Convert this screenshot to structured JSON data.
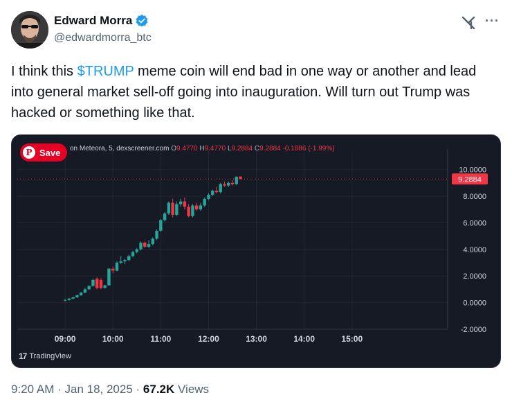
{
  "author": {
    "display_name": "Edward Morra",
    "handle": "@edwardmorra_btc",
    "verified": true
  },
  "tweet": {
    "text_before": "I think this ",
    "cashtag": "$TRUMP",
    "text_after": " meme coin will end bad in one way or another and lead into general market sell-off going into inauguration. Will turn out Trump was hacked or something like that."
  },
  "chart": {
    "source": "on Meteora, 5, dexscreener.com",
    "ohlc": {
      "o_label": "O",
      "o": "9.4770",
      "h_label": "H",
      "h": "9.4770",
      "l_label": "L",
      "l": "9.2884",
      "c_label": "C",
      "c": "9.2884",
      "change": "-0.1886 (-1.99%)"
    },
    "save_label": "Save",
    "brand": "TradingView",
    "last_price_label": "9.2884",
    "colors": {
      "up": "#26a69a",
      "down": "#f23645",
      "background": "#161a25",
      "grid": "#232733",
      "text": "#d1d4dc"
    }
  },
  "chart_data": {
    "type": "candlestick",
    "title": "",
    "y_ticks": [
      "10.0000",
      "8.0000",
      "6.0000",
      "4.0000",
      "2.0000",
      "0.0000",
      "-2.0000"
    ],
    "x_ticks": [
      "09:00",
      "10:00",
      "11:00",
      "12:00",
      "13:00",
      "14:00",
      "15:00"
    ],
    "ylim": [
      -2,
      10.5
    ],
    "xlim_minutes": [
      480,
      1020
    ],
    "candles": [
      {
        "t": 540,
        "o": 0.15,
        "h": 0.25,
        "l": 0.1,
        "c": 0.2
      },
      {
        "t": 545,
        "o": 0.2,
        "h": 0.35,
        "l": 0.15,
        "c": 0.3
      },
      {
        "t": 550,
        "o": 0.3,
        "h": 0.45,
        "l": 0.25,
        "c": 0.4
      },
      {
        "t": 555,
        "o": 0.4,
        "h": 0.6,
        "l": 0.35,
        "c": 0.55
      },
      {
        "t": 560,
        "o": 0.55,
        "h": 0.8,
        "l": 0.5,
        "c": 0.75
      },
      {
        "t": 565,
        "o": 0.75,
        "h": 1.1,
        "l": 0.7,
        "c": 1.0
      },
      {
        "t": 570,
        "o": 1.0,
        "h": 1.3,
        "l": 0.95,
        "c": 1.25
      },
      {
        "t": 575,
        "o": 1.25,
        "h": 1.8,
        "l": 1.2,
        "c": 1.7
      },
      {
        "t": 580,
        "o": 1.8,
        "h": 1.9,
        "l": 1.0,
        "c": 1.1
      },
      {
        "t": 585,
        "o": 1.7,
        "h": 1.85,
        "l": 1.0,
        "c": 1.1
      },
      {
        "t": 590,
        "o": 1.1,
        "h": 1.35,
        "l": 1.05,
        "c": 1.3
      },
      {
        "t": 595,
        "o": 1.3,
        "h": 2.6,
        "l": 1.25,
        "c": 2.55
      },
      {
        "t": 600,
        "o": 2.55,
        "h": 2.7,
        "l": 2.2,
        "c": 2.4
      },
      {
        "t": 605,
        "o": 2.4,
        "h": 3.1,
        "l": 2.35,
        "c": 3.0
      },
      {
        "t": 610,
        "o": 3.0,
        "h": 3.5,
        "l": 2.9,
        "c": 3.1
      },
      {
        "t": 615,
        "o": 3.1,
        "h": 3.3,
        "l": 2.9,
        "c": 3.2
      },
      {
        "t": 620,
        "o": 3.2,
        "h": 3.6,
        "l": 3.1,
        "c": 3.5
      },
      {
        "t": 625,
        "o": 3.5,
        "h": 3.9,
        "l": 3.4,
        "c": 3.8
      },
      {
        "t": 630,
        "o": 3.8,
        "h": 4.1,
        "l": 3.7,
        "c": 4.0
      },
      {
        "t": 635,
        "o": 4.0,
        "h": 4.6,
        "l": 3.9,
        "c": 4.5
      },
      {
        "t": 640,
        "o": 4.5,
        "h": 4.6,
        "l": 4.1,
        "c": 4.2
      },
      {
        "t": 645,
        "o": 4.2,
        "h": 4.7,
        "l": 4.1,
        "c": 4.4
      },
      {
        "t": 650,
        "o": 4.4,
        "h": 4.9,
        "l": 4.3,
        "c": 4.8
      },
      {
        "t": 655,
        "o": 4.8,
        "h": 5.5,
        "l": 4.7,
        "c": 5.4
      },
      {
        "t": 660,
        "o": 5.4,
        "h": 6.3,
        "l": 5.3,
        "c": 6.2
      },
      {
        "t": 665,
        "o": 6.2,
        "h": 6.8,
        "l": 6.1,
        "c": 6.7
      },
      {
        "t": 670,
        "o": 6.7,
        "h": 7.6,
        "l": 6.6,
        "c": 7.5
      },
      {
        "t": 675,
        "o": 7.5,
        "h": 7.8,
        "l": 6.4,
        "c": 6.6
      },
      {
        "t": 680,
        "o": 6.6,
        "h": 7.6,
        "l": 6.5,
        "c": 7.4
      },
      {
        "t": 685,
        "o": 7.4,
        "h": 7.8,
        "l": 7.2,
        "c": 7.6
      },
      {
        "t": 690,
        "o": 7.6,
        "h": 7.9,
        "l": 7.0,
        "c": 7.2
      },
      {
        "t": 695,
        "o": 7.2,
        "h": 7.4,
        "l": 6.4,
        "c": 6.5
      },
      {
        "t": 700,
        "o": 6.5,
        "h": 7.4,
        "l": 6.4,
        "c": 7.3
      },
      {
        "t": 705,
        "o": 7.3,
        "h": 7.5,
        "l": 6.9,
        "c": 7.0
      },
      {
        "t": 710,
        "o": 7.0,
        "h": 7.5,
        "l": 6.9,
        "c": 7.3
      },
      {
        "t": 715,
        "o": 7.3,
        "h": 7.9,
        "l": 7.2,
        "c": 7.8
      },
      {
        "t": 720,
        "o": 7.8,
        "h": 8.2,
        "l": 7.7,
        "c": 8.1
      },
      {
        "t": 725,
        "o": 8.1,
        "h": 8.5,
        "l": 8.0,
        "c": 8.4
      },
      {
        "t": 730,
        "o": 8.4,
        "h": 8.7,
        "l": 8.2,
        "c": 8.3
      },
      {
        "t": 735,
        "o": 8.3,
        "h": 9.0,
        "l": 8.2,
        "c": 8.9
      },
      {
        "t": 740,
        "o": 8.9,
        "h": 9.1,
        "l": 8.7,
        "c": 8.8
      },
      {
        "t": 745,
        "o": 8.8,
        "h": 9.1,
        "l": 8.7,
        "c": 9.0
      },
      {
        "t": 750,
        "o": 9.0,
        "h": 9.2,
        "l": 8.8,
        "c": 8.9
      },
      {
        "t": 755,
        "o": 8.9,
        "h": 9.5,
        "l": 8.85,
        "c": 9.45
      },
      {
        "t": 760,
        "o": 9.477,
        "h": 9.477,
        "l": 9.2884,
        "c": 9.2884
      }
    ]
  },
  "footer": {
    "time": "9:20 AM",
    "sep1": " · ",
    "date": "Jan 18, 2025",
    "sep2": " · ",
    "views_count": "67.2K",
    "views_label": " Views"
  }
}
